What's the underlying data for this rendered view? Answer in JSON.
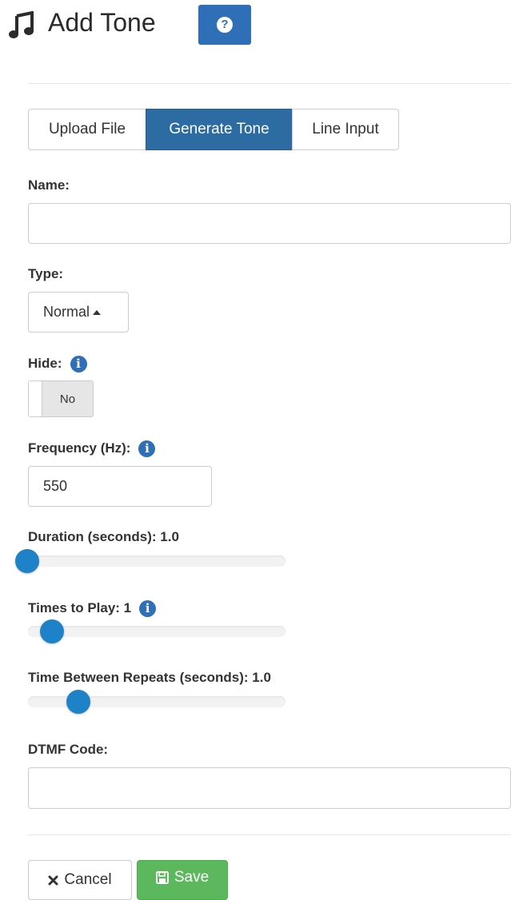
{
  "header": {
    "title": "Add Tone",
    "icon": "music-note-icon",
    "help_icon": "question-circle-icon",
    "help_symbol": "?"
  },
  "tabs": [
    {
      "label": "Upload File",
      "active": false
    },
    {
      "label": "Generate Tone",
      "active": true
    },
    {
      "label": "Line Input",
      "active": false
    }
  ],
  "form": {
    "name": {
      "label": "Name:",
      "value": "",
      "placeholder": ""
    },
    "type": {
      "label": "Type:",
      "selected": "Normal",
      "icon": "caret-up-icon"
    },
    "hide": {
      "label": "Hide:",
      "state": "No",
      "info_icon": "info-circle-icon"
    },
    "frequency": {
      "label": "Frequency (Hz):",
      "value": "550",
      "info_icon": "info-circle-icon"
    },
    "duration": {
      "label": "Duration (seconds): 1.0",
      "value": 1.0,
      "position_fraction": 0.0
    },
    "times_to_play": {
      "label": "Times to Play: 1",
      "value": 1,
      "position_fraction": 0.1,
      "info_icon": "info-circle-icon"
    },
    "time_between": {
      "label": "Time Between Repeats (seconds): 1.0",
      "value": 1.0,
      "position_fraction": 0.2
    },
    "dtmf": {
      "label": "DTMF Code:",
      "value": "",
      "placeholder": ""
    }
  },
  "actions": {
    "cancel_label": "Cancel",
    "cancel_icon": "times-icon",
    "save_label": "Save",
    "save_icon": "floppy-disk-icon"
  },
  "colors": {
    "primary": "#2f6fb7",
    "tab_active": "#2d6ca2",
    "slider_handle": "#1e82c9",
    "success": "#5cb85c"
  }
}
